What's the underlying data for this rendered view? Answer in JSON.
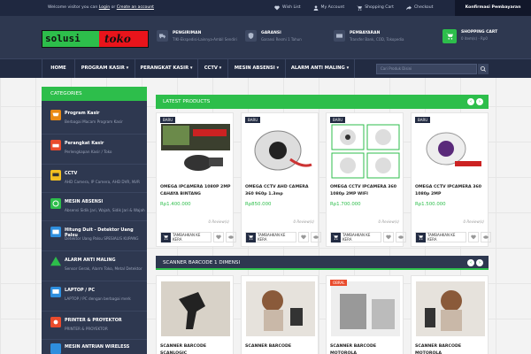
{
  "topbar": {
    "welcome_pre": "Welcome visitor you can ",
    "login": "Login",
    "or": " or ",
    "create": "Create an account",
    "links": [
      {
        "label": "Wish List",
        "icon": "heart-icon"
      },
      {
        "label": "My Account",
        "icon": "user-icon"
      },
      {
        "label": "Shopping Cart",
        "icon": "cart-icon"
      },
      {
        "label": "Checkout",
        "icon": "share-icon"
      }
    ],
    "confirm": "Konfirmasi Pembayaran"
  },
  "header": {
    "logo_part1": "solusi",
    "logo_part2": "toko",
    "info": [
      {
        "title": "PENGIRIMAN",
        "sub": "TIKI-Ekspedisi-Lainnya-Ambil Sendiri",
        "icon": "truck-icon"
      },
      {
        "title": "GARANSI",
        "sub": "Garansi Resmi 1 Tahun",
        "icon": "shield-icon"
      },
      {
        "title": "PEMBAYARAN",
        "sub": "Transfer Bank, COD, Tokopedia",
        "icon": "card-icon"
      }
    ],
    "cart_title": "SHOPPING CART",
    "cart_sub": "0 item(s) - Rp0"
  },
  "nav": {
    "items": [
      "HOME",
      "PROGRAM KASIR",
      "PERANGKAT KASIR",
      "CCTV",
      "MESIN ABSENSI",
      "ALARM ANTI MALING"
    ],
    "search_placeholder": "Cari Produk Disini"
  },
  "sidebar": {
    "title": "CATEGORIES",
    "items": [
      {
        "name": "Program Kasir",
        "sub": "Berbagai Macam Program Kasir",
        "icon": "cart-icon",
        "color": "#e98a15"
      },
      {
        "name": "Perangkat Kasir",
        "sub": "Perlengkapan Kasir / Toko",
        "icon": "printer-icon",
        "color": "#e94b2c"
      },
      {
        "name": "CCTV",
        "sub": "AHD Camera, IP Camera, AHD DVR, NVR",
        "icon": "cctv-icon",
        "color": "#f2c020"
      },
      {
        "name": "MESIN ABSENSI",
        "sub": "Absensi Sidik Jari, Wajah, Sidik Jari & Wajah",
        "icon": "fingerprint-icon",
        "color": "#2dbe4b"
      },
      {
        "name": "Hitung Duit - Detektor Uang Palsu",
        "sub": "Detektor Uang Palsu SPESIALIS KUPANG",
        "icon": "money-icon",
        "color": "#2e8ede"
      },
      {
        "name": "ALARM ANTI MALING",
        "sub": "Sensor Gerak, Alarm Toko, Metal Detektor",
        "icon": "alarm-icon",
        "color": "#2dbe4b"
      },
      {
        "name": "LAPTOP / PC",
        "sub": "LAPTOP / PC dengan berbagai merk",
        "icon": "laptop-icon",
        "color": "#2e8ede"
      },
      {
        "name": "PRINTER & PROYEKTOR",
        "sub": "PRINTER & PROYEKTOR",
        "icon": "projector-icon",
        "color": "#e94b2c"
      },
      {
        "name": "MESIN ANTRIAN WIRELESS",
        "sub": "",
        "icon": "queue-icon",
        "color": "#2e8ede"
      }
    ]
  },
  "latest": {
    "title": "LATEST PRODUCTS",
    "products": [
      {
        "badge": "BARU",
        "name": "OMEGA IPCAMERA 1080P 2MP CAHAYA BINTANG",
        "price": "Rp1.400.000",
        "reviews": "0 Review(s)",
        "cart": "TAMBAHKAN KE KERA",
        "image": "starlight-camera-image"
      },
      {
        "badge": "BARU",
        "name": "OMEGA CCTV AHD CAMERA 360 960p 1.3mp",
        "price": "Rp850.000",
        "reviews": "0 Review(s)",
        "cart": "TAMBAHKAN KE KERA",
        "image": "fisheye-camera-image"
      },
      {
        "badge": "BARU",
        "name": "OMEGA CCTV IPCAMERA 360 1080p 2MP WIFI",
        "price": "Rp1.700.000",
        "reviews": "0 Review(s)",
        "cart": "TAMBAHKAN KE KERA",
        "image": "wifi-camera-image"
      },
      {
        "badge": "BARU",
        "name": "OMEGA CCTV IPCAMERA 360 1080p 2MP",
        "price": "Rp1.500.000",
        "reviews": "0 Review(s)",
        "cart": "TAMBAHKAN KE KERA",
        "image": "panoramic-camera-image"
      }
    ]
  },
  "scanner": {
    "title": "SCANNER BARCODE 1 DIMENSI",
    "products": [
      {
        "name": "SCANNER BARCODE SCANLOGIC",
        "badge": ""
      },
      {
        "name": "SCANNER BARCODE",
        "badge": ""
      },
      {
        "name": "SCANNER BARCODE MOTOROLA",
        "badge": "OBRAL"
      },
      {
        "name": "SCANNER BARCODE MOTOROLA",
        "badge": ""
      }
    ]
  },
  "colors": {
    "accent": "#2dbe4b",
    "header": "#2e3850",
    "nav": "#222b42"
  }
}
